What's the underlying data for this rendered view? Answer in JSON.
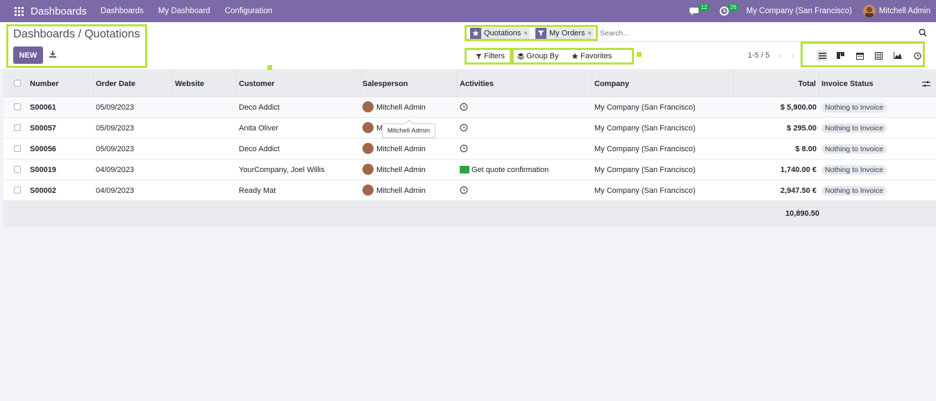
{
  "navbar": {
    "brand": "Dashboards",
    "menu": [
      "Dashboards",
      "My Dashboard",
      "Configuration"
    ],
    "messages_count": "12",
    "activities_count": "26",
    "company": "My Company (San Francisco)",
    "user": "Mitchell Admin"
  },
  "control_panel": {
    "breadcrumb": "Dashboards / Quotations",
    "new_label": "NEW",
    "facets": [
      "Quotations",
      "My Orders"
    ],
    "search_placeholder": "Search...",
    "filters_label": "Filters",
    "group_by_label": "Group By",
    "favorites_label": "Favorites",
    "pager": "1-5 / 5"
  },
  "table": {
    "columns": [
      "Number",
      "Order Date",
      "Website",
      "Customer",
      "Salesperson",
      "Activities",
      "Company",
      "Total",
      "Invoice Status"
    ],
    "rows": [
      {
        "number": "S00061",
        "date": "05/09/2023",
        "website": "",
        "customer": "Deco Addict",
        "salesperson": "Mitchell Admin",
        "activity": "",
        "company": "My Company (San Francisco)",
        "total": "$ 5,900.00",
        "status": "Nothing to Invoice"
      },
      {
        "number": "S00057",
        "date": "05/09/2023",
        "website": "",
        "customer": "Anita Oliver",
        "salesperson": "M",
        "activity": "",
        "company": "My Company (San Francisco)",
        "total": "$ 295.00",
        "status": "Nothing to Invoice"
      },
      {
        "number": "S00056",
        "date": "05/09/2023",
        "website": "",
        "customer": "Deco Addict",
        "salesperson": "Mitchell Admin",
        "activity": "",
        "company": "My Company (San Francisco)",
        "total": "$ 8.00",
        "status": "Nothing to Invoice"
      },
      {
        "number": "S00019",
        "date": "04/09/2023",
        "website": "",
        "customer": "YourCompany, Joel Willis",
        "salesperson": "Mitchell Admin",
        "activity": "Get quote confirmation",
        "company": "My Company (San Francisco)",
        "total": "1,740.00 €",
        "status": "Nothing to Invoice"
      },
      {
        "number": "S00002",
        "date": "04/09/2023",
        "website": "",
        "customer": "Ready Mat",
        "salesperson": "Mitchell Admin",
        "activity": "",
        "company": "My Company (San Francisco)",
        "total": "2,947.50 €",
        "status": "Nothing to Invoice"
      }
    ],
    "grand_total": "10,890.50",
    "tooltip": "Mitchell Admin"
  }
}
